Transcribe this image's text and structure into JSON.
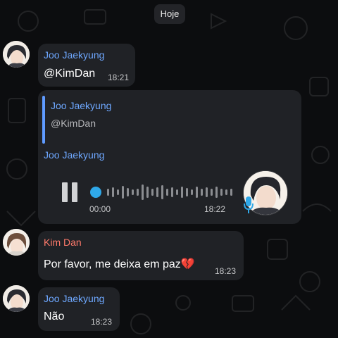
{
  "chat": {
    "date_chip": "Hoje",
    "messages": [
      {
        "sender": "Joo Jaekyung",
        "text": "@KimDan",
        "time": "18:21"
      },
      {
        "sender": "Joo Jaekyung",
        "reply_to": {
          "sender": "Joo Jaekyung",
          "text": "@KimDan"
        },
        "voice": {
          "elapsed": "00:00",
          "time": "18:22",
          "progress": 0
        }
      },
      {
        "sender": "Kim Dan",
        "text": "Por favor, me deixa em paz",
        "emoji": "💔",
        "time": "18:23"
      },
      {
        "sender": "Joo Jaekyung",
        "text": "Não",
        "time": "18:23"
      }
    ]
  },
  "colors": {
    "background": "#0c0d0f",
    "bubble": "#202226",
    "sender_blue": "#6ea8ff",
    "sender_red": "#ff7a6b",
    "reply_bar": "#5f9bff",
    "voice_accent": "#2fa8e8"
  },
  "icons": [
    "pause-icon",
    "microphone-icon",
    "broken-heart-emoji"
  ]
}
